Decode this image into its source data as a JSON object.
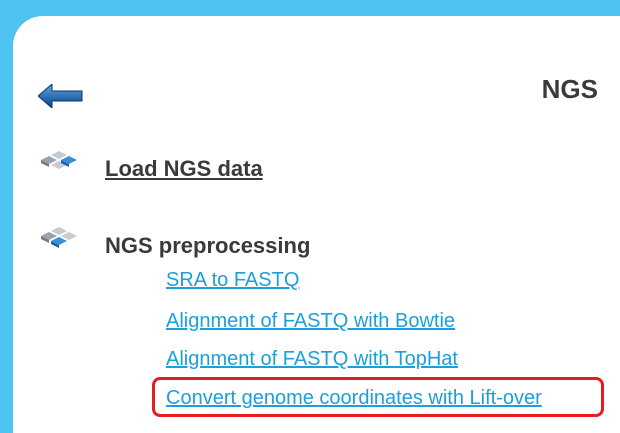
{
  "page": {
    "title": "NGS",
    "back_icon": "back-arrow-icon",
    "colors": {
      "frame": "#4fc3ef",
      "link": "#1c9fdb",
      "text": "#3a3a3a",
      "highlight": "#e31d23"
    }
  },
  "sections": [
    {
      "icon": "cubes-icon",
      "label": "Load NGS data",
      "is_link": true
    },
    {
      "icon": "cubes-icon",
      "label": "NGS preprocessing",
      "is_link": false,
      "items": [
        {
          "label": "SRA to FASTQ"
        },
        {
          "label": "Alignment of FASTQ with Bowtie"
        },
        {
          "label": "Alignment of FASTQ with TopHat"
        },
        {
          "label": "Convert genome coordinates with Lift-over",
          "highlighted": true
        }
      ]
    }
  ]
}
